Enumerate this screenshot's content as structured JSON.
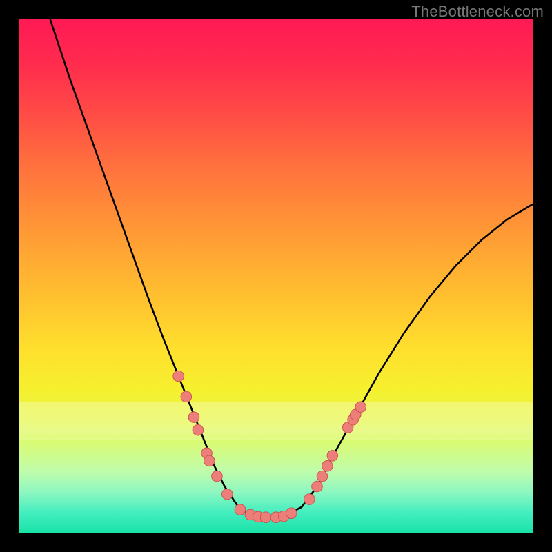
{
  "watermark": "TheBottleneck.com",
  "colors": {
    "frame": "#000000",
    "gradient_top": "#ff1a55",
    "gradient_bottom": "#1ae3a7",
    "curve": "#000000",
    "marker_fill": "#ed7f7a",
    "marker_stroke": "#c94f4a"
  },
  "chart_data": {
    "type": "line",
    "title": "",
    "xlabel": "",
    "ylabel": "",
    "xlim": [
      0,
      100
    ],
    "ylim": [
      0,
      100
    ],
    "note": "V-shaped bottleneck curve; y is read as percentage of plot height from bottom, x as percentage from left. Values estimated from pixel positions (no axis ticks shown).",
    "series": [
      {
        "name": "bottleneck-curve",
        "x": [
          6,
          10,
          15,
          20,
          25,
          28,
          30,
          32,
          34,
          36,
          38,
          40,
          42,
          43,
          45,
          48,
          50,
          52,
          55,
          58,
          60,
          65,
          70,
          75,
          80,
          85,
          90,
          95,
          100
        ],
        "y": [
          100,
          88,
          74,
          60,
          46,
          38,
          33,
          28,
          23,
          18,
          13,
          9,
          6,
          4.5,
          3.5,
          3,
          3,
          3.5,
          5,
          9,
          13,
          22,
          31,
          39,
          46,
          52,
          57,
          61,
          64
        ]
      }
    ],
    "markers": [
      {
        "x": 31.0,
        "y": 30.5
      },
      {
        "x": 32.5,
        "y": 26.5
      },
      {
        "x": 34.0,
        "y": 22.5
      },
      {
        "x": 34.8,
        "y": 20.0
      },
      {
        "x": 36.5,
        "y": 15.5
      },
      {
        "x": 37.0,
        "y": 14.0
      },
      {
        "x": 38.5,
        "y": 11.0
      },
      {
        "x": 40.5,
        "y": 7.5
      },
      {
        "x": 43.0,
        "y": 4.5
      },
      {
        "x": 45.0,
        "y": 3.5
      },
      {
        "x": 46.5,
        "y": 3.1
      },
      {
        "x": 48.0,
        "y": 3.0
      },
      {
        "x": 50.0,
        "y": 3.0
      },
      {
        "x": 51.5,
        "y": 3.2
      },
      {
        "x": 53.0,
        "y": 3.8
      },
      {
        "x": 56.5,
        "y": 6.5
      },
      {
        "x": 58.0,
        "y": 9.0
      },
      {
        "x": 59.0,
        "y": 11.0
      },
      {
        "x": 60.0,
        "y": 13.0
      },
      {
        "x": 61.0,
        "y": 15.0
      },
      {
        "x": 64.0,
        "y": 20.5
      },
      {
        "x": 65.0,
        "y": 22.0
      },
      {
        "x": 65.5,
        "y": 23.0
      },
      {
        "x": 66.5,
        "y": 24.5
      }
    ]
  }
}
